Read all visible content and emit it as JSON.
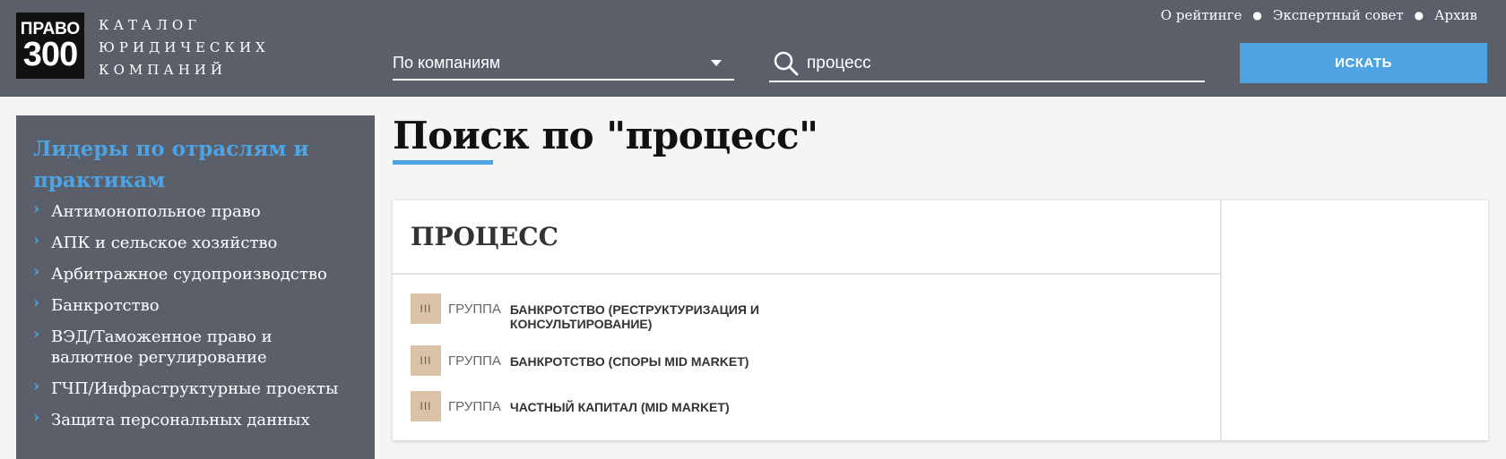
{
  "logo": {
    "line1": "ПРАВО",
    "line2": "300"
  },
  "catalog": {
    "lines": [
      "КАТАЛОГ",
      "ЮРИДИЧЕСКИХ",
      "КОМПАНИЙ"
    ]
  },
  "topnav": [
    "О рейтинге",
    "Экспертный совет",
    "Архив"
  ],
  "search": {
    "filter_value": "По компаниям",
    "query": "процесс",
    "button_label": "ИСКАТЬ"
  },
  "sidebar": {
    "title": "Лидеры по отраслям и практикам",
    "items": [
      "Антимонопольное право",
      "АПК и сельское хозяйство",
      "Арбитражное судопроизводство",
      "Банкротство",
      "ВЭД/Таможенное право и валютное регулирование",
      "ГЧП/Инфраструктурные проекты",
      "Защита персональных данных"
    ]
  },
  "main": {
    "title": "Поиск по \"процесс\"",
    "card": {
      "heading": "ПРОЦЕСС",
      "results": [
        {
          "badge": "III",
          "group": "ГРУППА",
          "name": "БАНКРОТСТВО (РЕСТРУКТУРИЗАЦИЯ И КОНСУЛЬТИРОВАНИЕ)"
        },
        {
          "badge": "III",
          "group": "ГРУППА",
          "name": "БАНКРОТСТВО (СПОРЫ MID MARKET)"
        },
        {
          "badge": "III",
          "group": "ГРУППА",
          "name": "ЧАСТНЫЙ КАПИТАЛ (MID MARKET)"
        }
      ]
    }
  },
  "colors": {
    "header_bg": "#5a5f6a",
    "accent": "#4ea4e3",
    "badge_bg": "#d9c2a6"
  }
}
